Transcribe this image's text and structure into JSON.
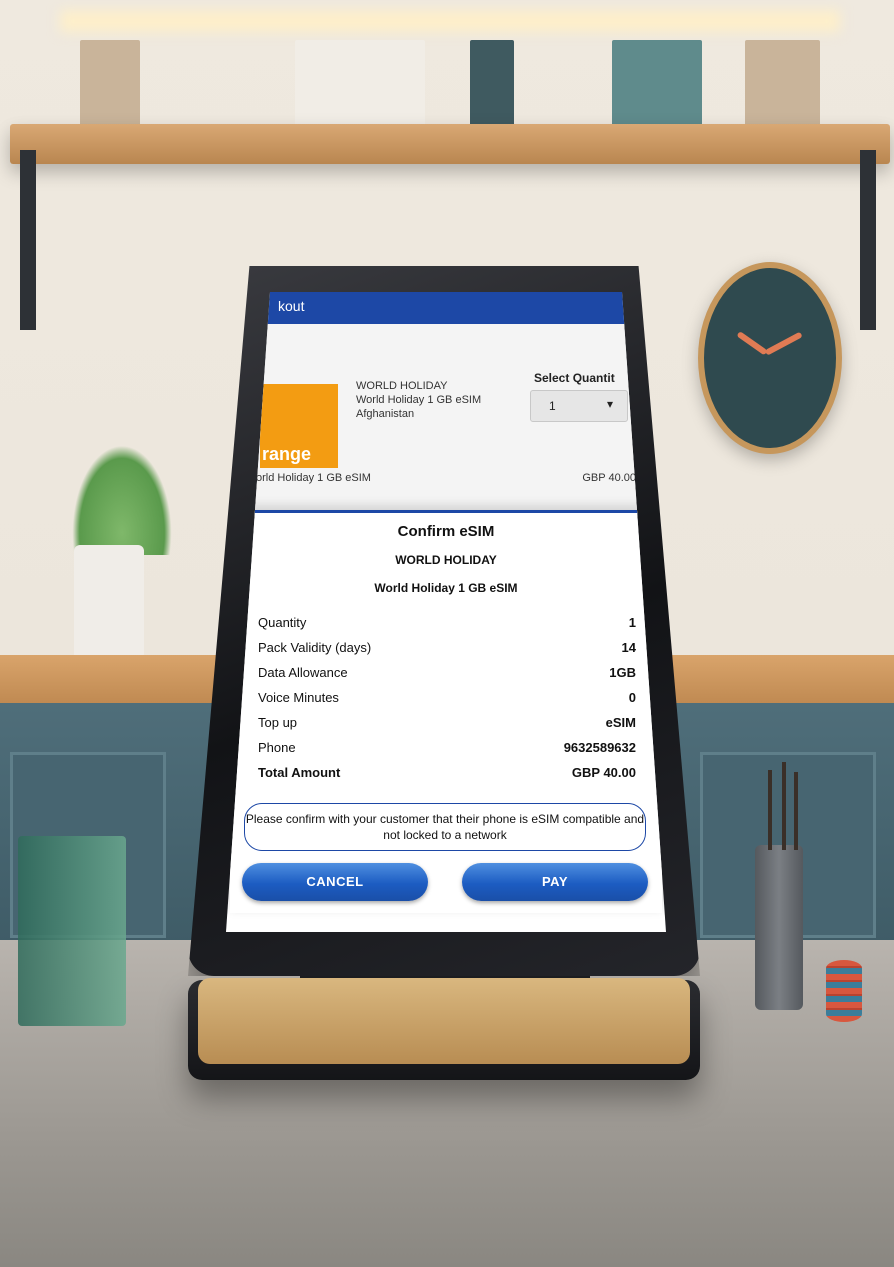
{
  "app": {
    "title": "kout"
  },
  "product": {
    "logo_text": "range",
    "provider": "WORLD HOLIDAY",
    "plan": "World Holiday 1 GB eSIM",
    "country": "Afghanistan",
    "quantity_label": "Select Quantit",
    "quantity_value": "1",
    "summary_name": "orld Holiday 1 GB eSIM",
    "summary_price": "GBP 40.00"
  },
  "dialog": {
    "title": "Confirm eSIM",
    "provider": "WORLD HOLIDAY",
    "plan": "World Holiday 1 GB eSIM",
    "rows": [
      {
        "label": "Quantity",
        "value": "1"
      },
      {
        "label": "Pack Validity (days)",
        "value": "14"
      },
      {
        "label": "Data Allowance",
        "value": "1GB"
      },
      {
        "label": "Voice Minutes",
        "value": "0"
      },
      {
        "label": "Top up",
        "value": "eSIM"
      },
      {
        "label": "Phone",
        "value": "9632589632"
      },
      {
        "label": "Total Amount",
        "value": "GBP 40.00"
      }
    ],
    "notice": "Please confirm with your customer that their phone is eSIM compatible and not locked to a network",
    "cancel_label": "CANCEL",
    "pay_label": "PAY"
  },
  "colors": {
    "primary": "#1d48a6",
    "button": "#1c5cc2",
    "orange": "#f39c12"
  }
}
